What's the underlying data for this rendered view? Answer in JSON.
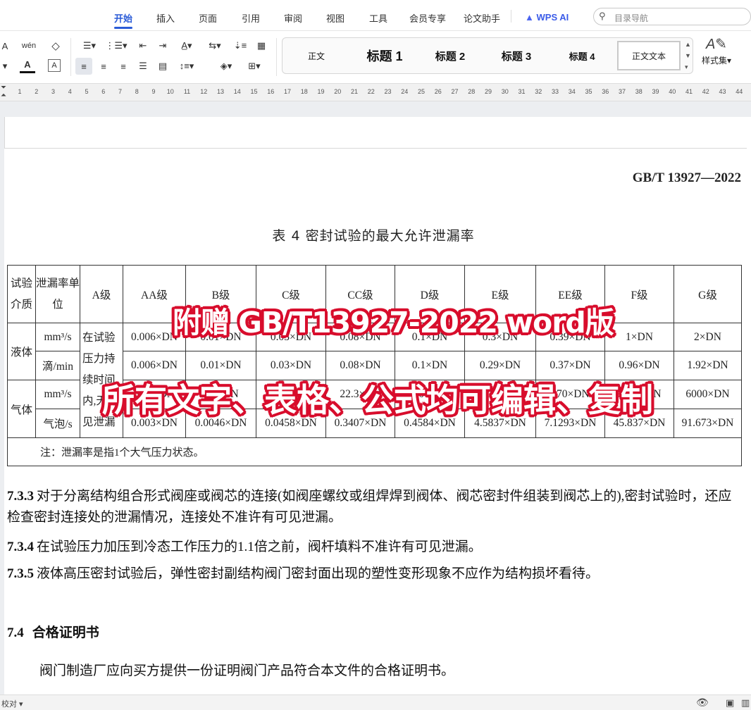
{
  "menubar": {
    "tabs": [
      "开始",
      "插入",
      "页面",
      "引用",
      "审阅",
      "视图",
      "工具",
      "会员专享",
      "论文助手"
    ],
    "active_tab": "开始",
    "wps_ai": "WPS AI",
    "search_placeholder": "目录导航"
  },
  "toolbar": {
    "font_small_icon_label": "A",
    "wen_label": "wén",
    "styles": [
      "正文",
      "标题 1",
      "标题 2",
      "标题 3",
      "标题 4",
      "正文文本"
    ],
    "style_set_label": "样式集"
  },
  "ruler": {
    "numbers": [
      "1",
      "2",
      "3",
      "4",
      "5",
      "6",
      "7",
      "8",
      "9",
      "10",
      "11",
      "12",
      "13",
      "14",
      "15",
      "16",
      "17",
      "18",
      "19",
      "20",
      "21",
      "22",
      "23",
      "24",
      "25",
      "26",
      "27",
      "28",
      "29",
      "30",
      "31",
      "32",
      "33",
      "34",
      "35",
      "36",
      "37",
      "38",
      "39",
      "40",
      "41",
      "42",
      "43",
      "44"
    ]
  },
  "document": {
    "std_number": "GB/T 13927—2022",
    "table_title": "表 4  密封试验的最大允许泄漏率",
    "table": {
      "h_medium": "试验介质",
      "h_unit": "泄漏率单位",
      "grades": [
        "A级",
        "AA级",
        "B级",
        "C级",
        "CC级",
        "D级",
        "E级",
        "EE级",
        "F级",
        "G级"
      ],
      "liquid": "液体",
      "gas": "气体",
      "a_grade_desc": "在试验压力持续时间内,无可见泄漏",
      "rows": [
        {
          "unit": "mm³/s",
          "values": [
            "0.006×DN",
            "0.01×DN",
            "0.03×DN",
            "0.08×DN",
            "0.1×DN",
            "0.3×DN",
            "0.39×DN",
            "1×DN",
            "2×DN"
          ]
        },
        {
          "unit": "滴/min",
          "values": [
            "0.006×DN",
            "0.01×DN",
            "0.03×DN",
            "0.08×DN",
            "0.1×DN",
            "0.29×DN",
            "0.37×DN",
            "0.96×DN",
            "1.92×DN"
          ]
        },
        {
          "unit": "mm³/s",
          "values": [
            "0.18×DN",
            "0.3×DN",
            "3×DN",
            "22.3×DN",
            "30×DN",
            "300×DN",
            "470×DN",
            "3000×DN",
            "6000×DN"
          ]
        },
        {
          "unit": "气泡/s",
          "values": [
            "0.003×DN",
            "0.0046×DN",
            "0.0458×DN",
            "0.3407×DN",
            "0.4584×DN",
            "4.5837×DN",
            "7.1293×DN",
            "45.837×DN",
            "91.673×DN"
          ]
        }
      ],
      "note": "注：泄漏率是指1个大气压力状态。"
    },
    "paragraphs": [
      {
        "num": "7.3.3",
        "text": "对于分离结构组合形式阀座或阀芯的连接(如阀座螺纹或组焊焊到阀体、阀芯密封件组装到阀芯上的),密封试验时，还应检查密封连接处的泄漏情况，连接处不准许有可见泄漏。"
      },
      {
        "num": "7.3.4",
        "text": "在试验压力加压到冷态工作压力的1.1倍之前，阀杆填料不准许有可见泄漏。"
      },
      {
        "num": "7.3.5",
        "text": "液体高压密封试验后，弹性密封副结构阀门密封面出现的塑性变形现象不应作为结构损坏看待。"
      }
    ],
    "section_num": "7.4",
    "section_title": "合格证明书",
    "section_body": "阀门制造厂应向买方提供一份证明阀门产品符合本文件的合格证明书。"
  },
  "overlay": {
    "line1": "附赠 GB/T13927-2022 word版",
    "line2": "所有文字、表格、公式均可编辑、复制",
    "text_color": "#ffffff",
    "outline_color": "#d80d2c"
  },
  "statusbar": {
    "proofread": "校对"
  }
}
